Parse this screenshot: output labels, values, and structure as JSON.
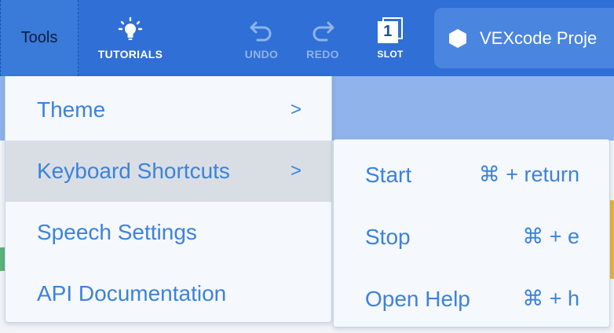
{
  "toolbar": {
    "tools_label": "Tools",
    "tutorials_label": "TUTORIALS",
    "undo_label": "UNDO",
    "redo_label": "REDO",
    "slot_label": "SLOT",
    "slot_number": "1",
    "project_name": "VEXcode Proje"
  },
  "tools_menu": {
    "items": [
      {
        "label": "Theme",
        "arrow": ">"
      },
      {
        "label": "Keyboard Shortcuts",
        "arrow": ">"
      },
      {
        "label": "Speech Settings",
        "arrow": ""
      },
      {
        "label": "API Documentation",
        "arrow": ""
      }
    ]
  },
  "shortcuts_menu": {
    "items": [
      {
        "label": "Start",
        "key": "⌘ + return"
      },
      {
        "label": "Stop",
        "key": "⌘ + e"
      },
      {
        "label": "Open Help",
        "key": "⌘ + h"
      }
    ]
  },
  "colors": {
    "toolbar_bg": "#2f6fd6",
    "menu_text": "#3c82db",
    "menu_active_bg": "#d9dee5"
  }
}
